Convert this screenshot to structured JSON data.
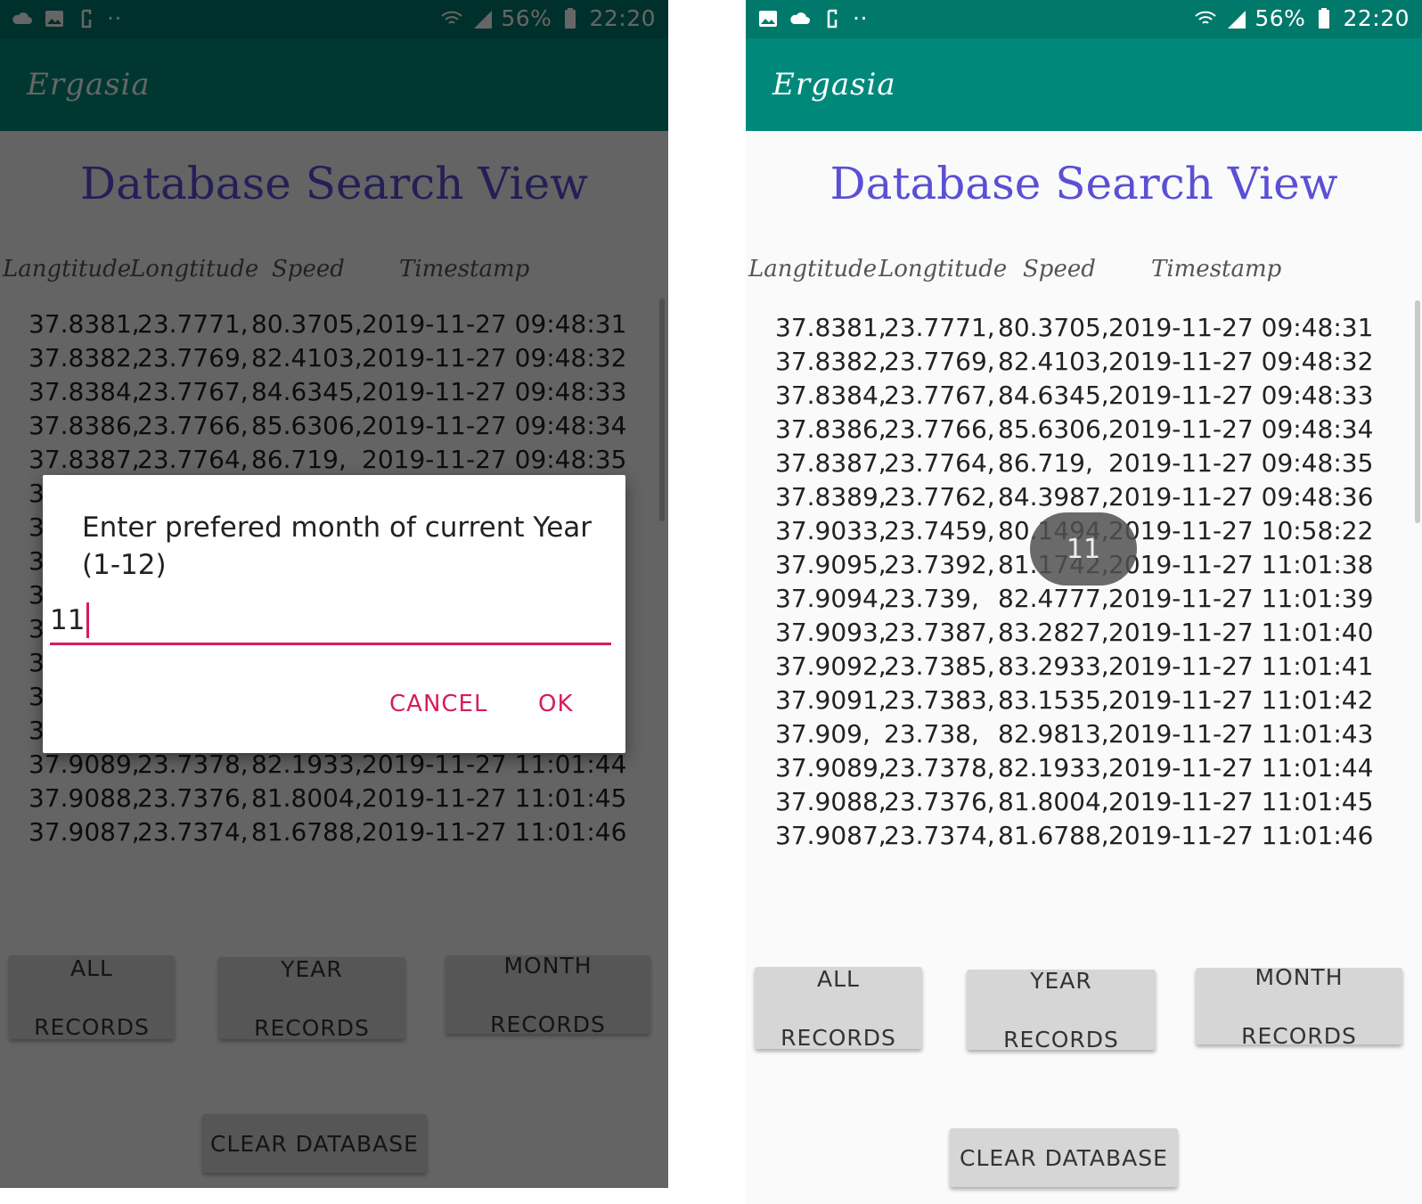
{
  "status": {
    "battery": "56%",
    "time": "22:20"
  },
  "app": {
    "title": "Ergasia"
  },
  "screen": {
    "title": "Database Search View",
    "headers": [
      "Langtitude",
      "Longtitude",
      "Speed",
      "Timestamp"
    ]
  },
  "records": [
    [
      "37.8381,",
      "23.7771,",
      "80.3705,",
      "2019-11-27 09:48:31"
    ],
    [
      "37.8382,",
      "23.7769,",
      "82.4103,",
      "2019-11-27 09:48:32"
    ],
    [
      "37.8384,",
      "23.7767,",
      "84.6345,",
      "2019-11-27 09:48:33"
    ],
    [
      "37.8386,",
      "23.7766,",
      "85.6306,",
      "2019-11-27 09:48:34"
    ],
    [
      "37.8387,",
      "23.7764,",
      "86.719,",
      "2019-11-27 09:48:35"
    ],
    [
      "37.8389,",
      "23.7762,",
      "84.3987,",
      "2019-11-27 09:48:36"
    ],
    [
      "37.9033,",
      "23.7459,",
      "80.1494,",
      "2019-11-27 10:58:22"
    ],
    [
      "37.9095,",
      "23.7392,",
      "81.1742,",
      "2019-11-27 11:01:38"
    ],
    [
      "37.9094,",
      "23.739,",
      "82.4777,",
      "2019-11-27 11:01:39"
    ],
    [
      "37.9093,",
      "23.7387,",
      "83.2827,",
      "2019-11-27 11:01:40"
    ],
    [
      "37.9092,",
      "23.7385,",
      "83.2933,",
      "2019-11-27 11:01:41"
    ],
    [
      "37.9091,",
      "23.7383,",
      "83.1535,",
      "2019-11-27 11:01:42"
    ],
    [
      "37.909,",
      "23.738,",
      "82.9813,",
      "2019-11-27 11:01:43"
    ],
    [
      "37.9089,",
      "23.7378,",
      "82.1933,",
      "2019-11-27 11:01:44"
    ],
    [
      "37.9088,",
      "23.7376,",
      "81.8004,",
      "2019-11-27 11:01:45"
    ],
    [
      "37.9087,",
      "23.7374,",
      "81.6788,",
      "2019-11-27 11:01:46"
    ]
  ],
  "buttons": {
    "all": "ALL RECORDS",
    "year": "YEAR RECORDS",
    "month": "MONTH RECORDS",
    "clear": "CLEAR DATABASE"
  },
  "dialog": {
    "message": "Enter prefered month of current Year (1-12)",
    "input_value": "11",
    "cancel": "CANCEL",
    "ok": "OK"
  },
  "toast": {
    "text": "11"
  },
  "colors": {
    "status_bar": "#00796b",
    "app_bar": "#00897b",
    "title": "#5b4fd6",
    "accent": "#d81b60",
    "button": "#d6d6d6"
  }
}
